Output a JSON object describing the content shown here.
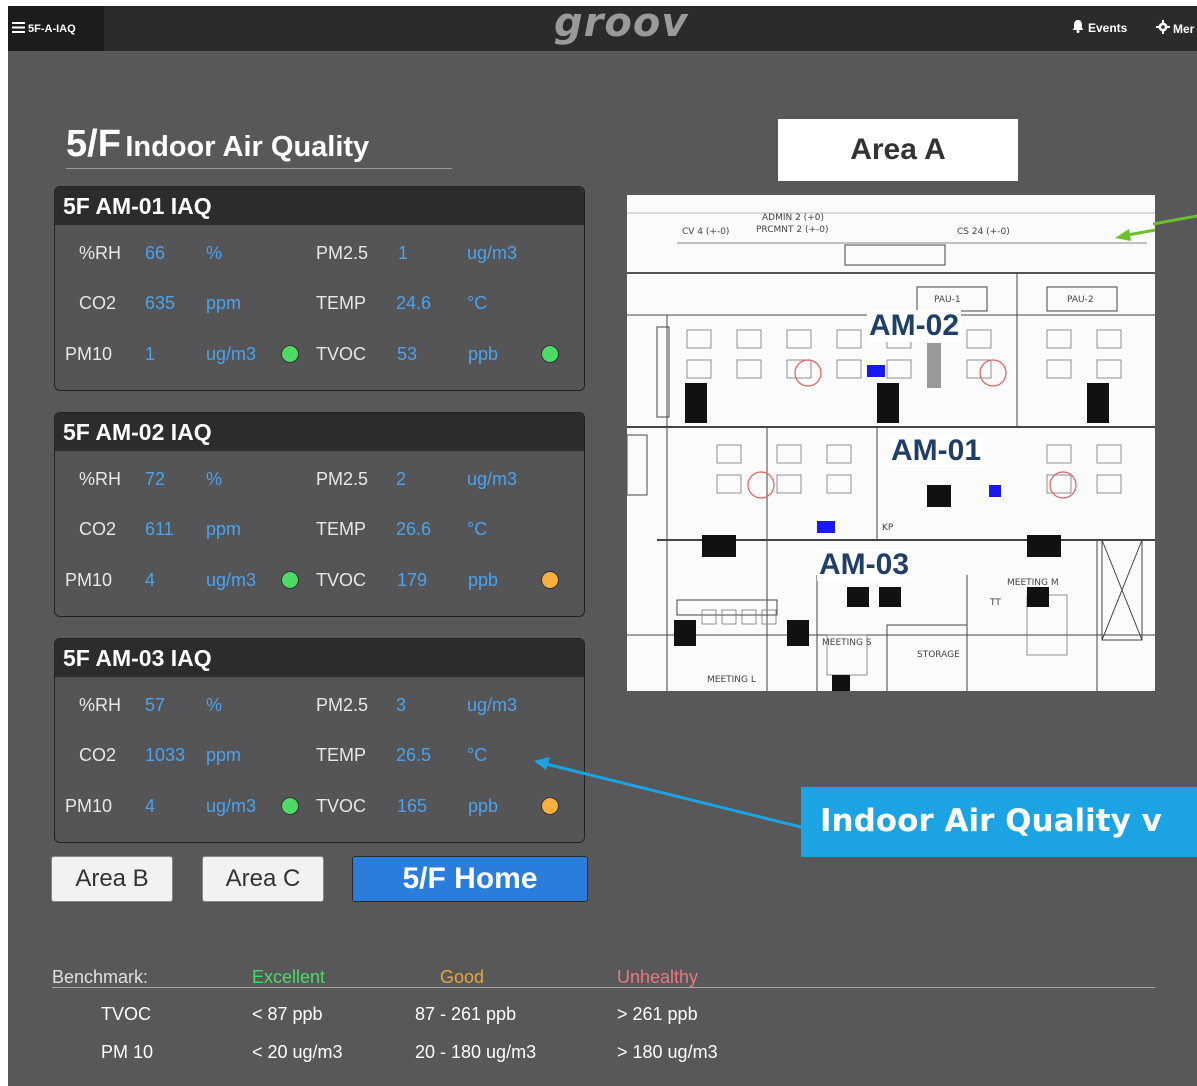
{
  "topbar": {
    "menu_label": "5F-A-IAQ",
    "logo": "groov",
    "events_label": "Events",
    "more_label": "Mer"
  },
  "title": {
    "big": "5/F",
    "small": "Indoor Air Quality"
  },
  "panels": [
    {
      "title": "5F AM-01 IAQ",
      "rh": {
        "label": "%RH",
        "value": "66",
        "unit": "%"
      },
      "pm25": {
        "label": "PM2.5",
        "value": "1",
        "unit": "ug/m3"
      },
      "co2": {
        "label": "CO2",
        "value": "635",
        "unit": "ppm"
      },
      "temp": {
        "label": "TEMP",
        "value": "24.6",
        "unit": "°C"
      },
      "pm10": {
        "label": "PM10",
        "value": "1",
        "unit": "ug/m3",
        "status_color": "#4cd964"
      },
      "tvoc": {
        "label": "TVOC",
        "value": "53",
        "unit": "ppb",
        "status_color": "#4cd964"
      }
    },
    {
      "title": "5F AM-02 IAQ",
      "rh": {
        "label": "%RH",
        "value": "72",
        "unit": "%"
      },
      "pm25": {
        "label": "PM2.5",
        "value": "2",
        "unit": "ug/m3"
      },
      "co2": {
        "label": "CO2",
        "value": "611",
        "unit": "ppm"
      },
      "temp": {
        "label": "TEMP",
        "value": "26.6",
        "unit": "°C"
      },
      "pm10": {
        "label": "PM10",
        "value": "4",
        "unit": "ug/m3",
        "status_color": "#4cd964"
      },
      "tvoc": {
        "label": "TVOC",
        "value": "179",
        "unit": "ppb",
        "status_color": "#f5b041"
      }
    },
    {
      "title": "5F AM-03 IAQ",
      "rh": {
        "label": "%RH",
        "value": "57",
        "unit": "%"
      },
      "pm25": {
        "label": "PM2.5",
        "value": "3",
        "unit": "ug/m3"
      },
      "co2": {
        "label": "CO2",
        "value": "1033",
        "unit": "ppm"
      },
      "temp": {
        "label": "TEMP",
        "value": "26.5",
        "unit": "°C"
      },
      "pm10": {
        "label": "PM10",
        "value": "4",
        "unit": "ug/m3",
        "status_color": "#4cd964"
      },
      "tvoc": {
        "label": "TVOC",
        "value": "165",
        "unit": "ppb",
        "status_color": "#f5b041"
      }
    }
  ],
  "area_title": "Area A",
  "floorplan": {
    "labels": [
      "AM-02",
      "AM-01",
      "AM-03"
    ],
    "room_texts": [
      "ADMIN 2 (+0)",
      "PRCMNT 2 (+-0)",
      "CV 4 (+-0)",
      "CS 24 (+-0)",
      "STORAGE",
      "MEETING L",
      "MEETING M",
      "MEETING S",
      "PAU-1",
      "PAU-2",
      "KP",
      "TT"
    ]
  },
  "banner": "Indoor Air Quality v",
  "nav": {
    "area_b": "Area B",
    "area_c": "Area C",
    "home": "5/F Home"
  },
  "benchmark": {
    "heading": "Benchmark:",
    "levels": {
      "excellent": "Excellent",
      "good": "Good",
      "unhealthy": "Unhealthy"
    },
    "colors": {
      "excellent": "#4cd964",
      "good": "#e8a33c",
      "unhealthy": "#e8787a"
    },
    "rows": [
      {
        "name": "TVOC",
        "excellent": "< 87 ppb",
        "good": "87 - 261 ppb",
        "unhealthy": "> 261 ppb"
      },
      {
        "name": "PM 10",
        "excellent": "< 20 ug/m3",
        "good": "20 - 180 ug/m3",
        "unhealthy": "> 180 ug/m3"
      }
    ]
  }
}
